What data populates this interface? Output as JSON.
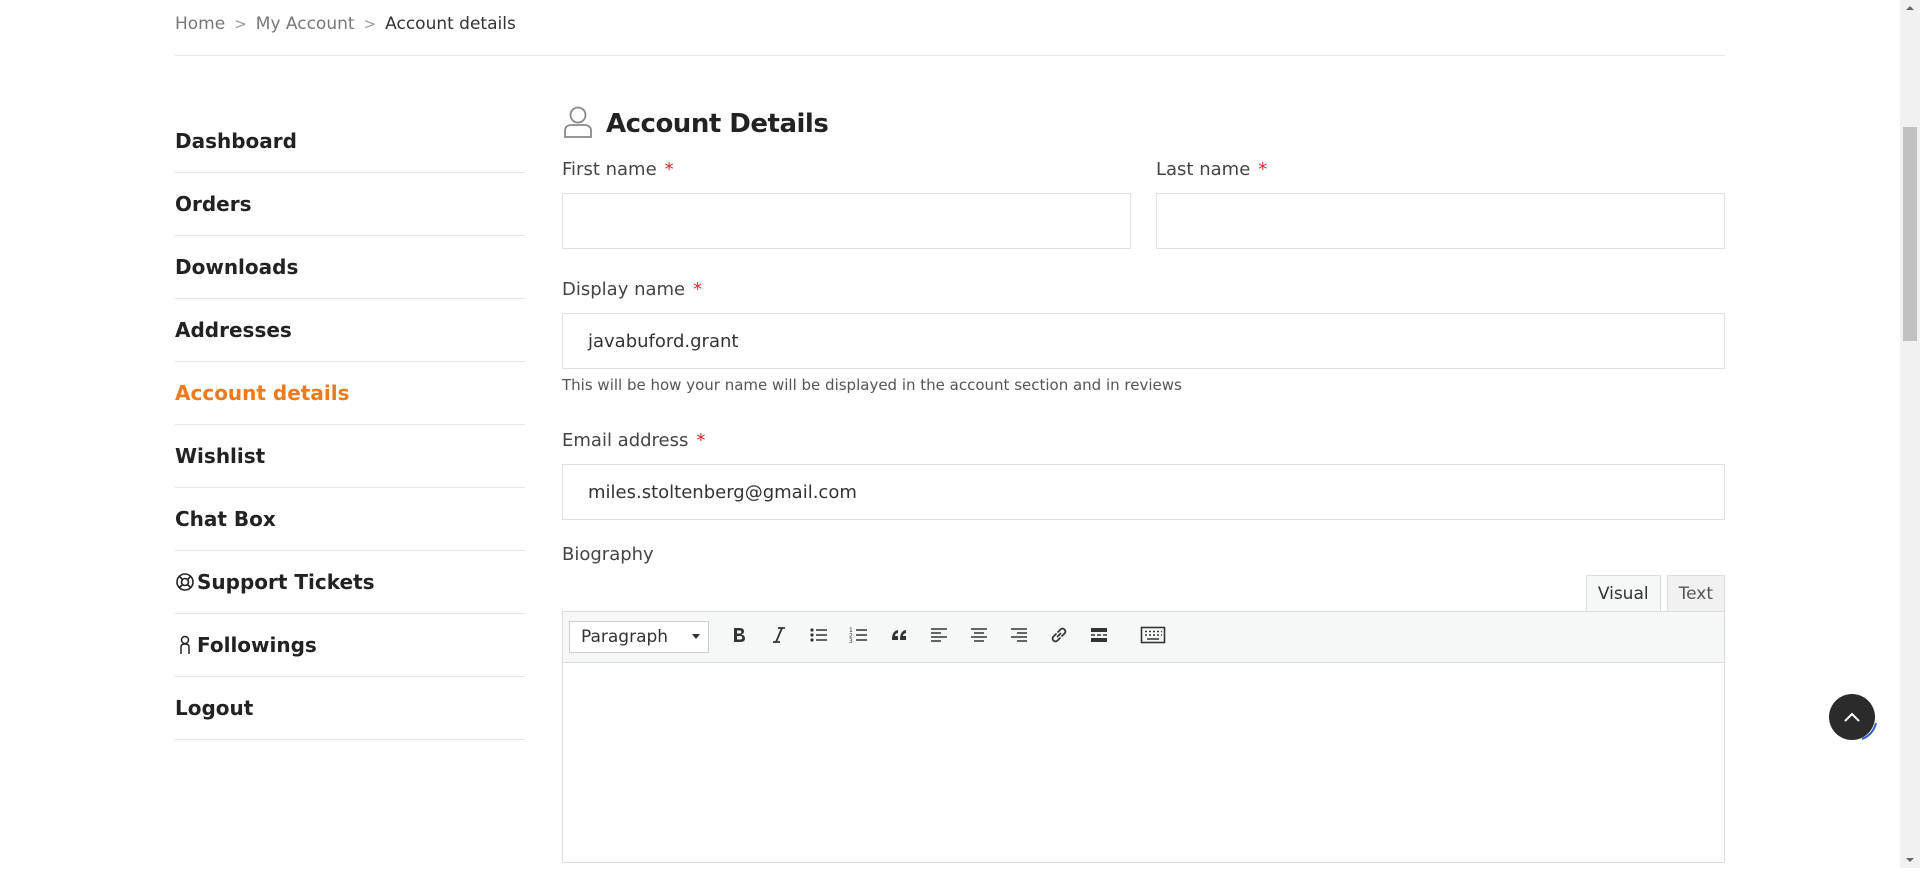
{
  "breadcrumb": {
    "home": "Home",
    "account": "My Account",
    "current": "Account details",
    "separator": ">"
  },
  "sidebar": {
    "items": [
      {
        "label": "Dashboard"
      },
      {
        "label": "Orders"
      },
      {
        "label": "Downloads"
      },
      {
        "label": "Addresses"
      },
      {
        "label": "Account details",
        "active": true
      },
      {
        "label": "Wishlist"
      },
      {
        "label": "Chat Box"
      },
      {
        "label": "Support Tickets",
        "icon": "lifebuoy-icon"
      },
      {
        "label": "Followings",
        "icon": "user-icon"
      },
      {
        "label": "Logout"
      }
    ]
  },
  "main": {
    "title": "Account Details",
    "title_icon": "user-icon",
    "first_name": {
      "label": "First name",
      "required_mark": "*",
      "value": ""
    },
    "last_name": {
      "label": "Last name",
      "required_mark": "*",
      "value": ""
    },
    "display_name": {
      "label": "Display name",
      "required_mark": "*",
      "value": "javabuford.grant",
      "help": "This will be how your name will be displayed in the account section and in reviews"
    },
    "email": {
      "label": "Email address",
      "required_mark": "*",
      "value": "miles.stoltenberg@gmail.com"
    },
    "biography": {
      "label": "Biography",
      "tabs": {
        "visual": "Visual",
        "text": "Text"
      },
      "format_select": "Paragraph",
      "toolbar_icons": [
        "bold-icon",
        "italic-icon",
        "bullet-list-icon",
        "numbered-list-icon",
        "blockquote-icon",
        "align-left-icon",
        "align-center-icon",
        "align-right-icon",
        "link-icon",
        "read-more-icon",
        "keyboard-icon"
      ]
    }
  },
  "colors": {
    "accent": "#ee7a1c",
    "required": "#e02424",
    "text": "#222222",
    "to_top_bg": "#2b2b2b"
  }
}
